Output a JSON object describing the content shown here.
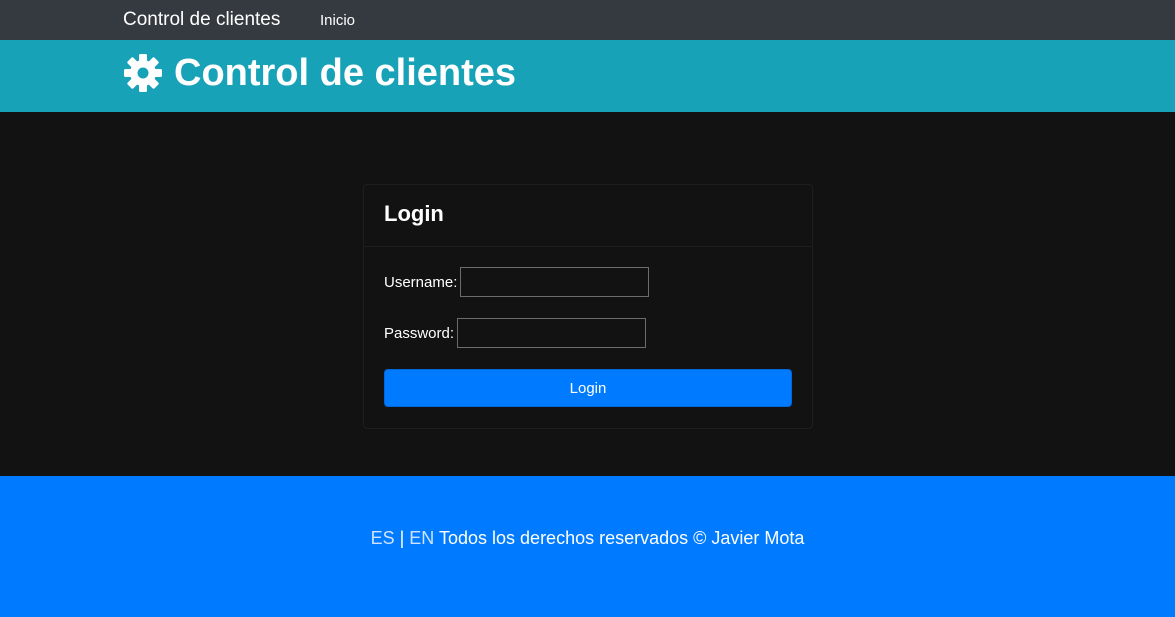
{
  "navbar": {
    "brand": "Control de clientes",
    "links": [
      "Inicio"
    ]
  },
  "hero": {
    "icon": "gear-icon",
    "title": "Control de clientes"
  },
  "login": {
    "title": "Login",
    "username_label": "Username:",
    "username_value": "",
    "password_label": "Password:",
    "password_value": "",
    "submit_label": "Login"
  },
  "footer": {
    "lang_es": "ES",
    "separator": "|",
    "lang_en": "EN",
    "copyright": "Todos los derechos reservados © Javier Mota"
  },
  "colors": {
    "navbar": "#343a40",
    "hero": "#17a2b8",
    "primary": "#007bff",
    "background": "#121212"
  }
}
